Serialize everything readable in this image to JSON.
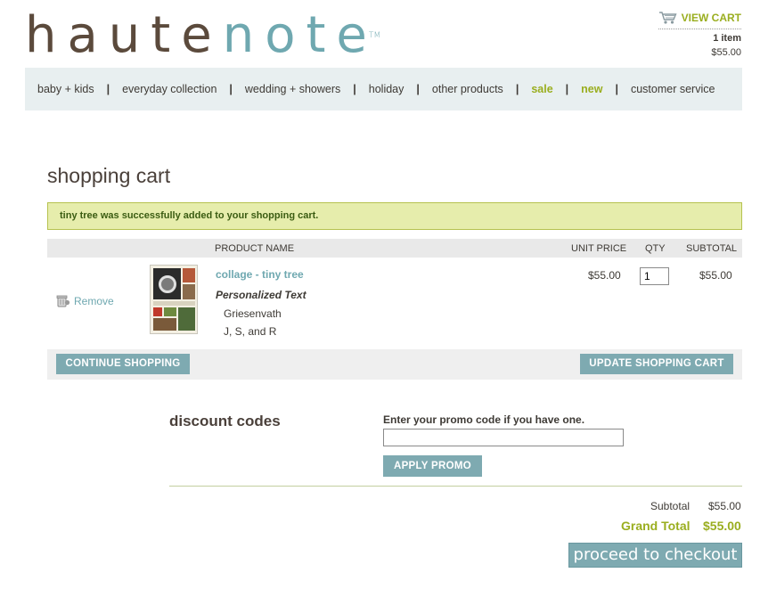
{
  "brand": {
    "word1": "haute",
    "word2": "note",
    "tm": "TM"
  },
  "cart_summary": {
    "view_label": "VIEW CART",
    "items": "1 item",
    "total": "$55.00"
  },
  "nav": [
    "baby + kids",
    "everyday collection",
    "wedding + showers",
    "holiday",
    "other products",
    "sale",
    "new",
    "customer service"
  ],
  "page_title": "shopping cart",
  "success_message": "tiny tree was successfully added to your shopping cart.",
  "table": {
    "headers": {
      "product_name": "PRODUCT NAME",
      "unit_price": "UNIT PRICE",
      "qty": "QTY",
      "subtotal": "SUBTOTAL"
    },
    "item": {
      "remove_label": "Remove",
      "name": "collage - tiny tree",
      "option_label": "Personalized Text",
      "option_line1": "Griesenvath",
      "option_line2": "J, S, and R",
      "unit_price": "$55.00",
      "qty": "1",
      "subtotal": "$55.00"
    }
  },
  "buttons": {
    "continue": "CONTINUE SHOPPING",
    "update": "UPDATE SHOPPING CART",
    "apply": "APPLY PROMO",
    "checkout": "proceed to checkout"
  },
  "discount": {
    "title": "discount codes",
    "label": "Enter your promo code if you have one.",
    "value": ""
  },
  "totals": {
    "subtotal_label": "Subtotal",
    "subtotal_value": "$55.00",
    "grand_label": "Grand Total",
    "grand_value": "$55.00"
  },
  "colors": {
    "accent_teal": "#7eaab1",
    "accent_green": "#9aae1f",
    "nav_bg": "#e8eff0",
    "message_bg": "#e6edac"
  }
}
